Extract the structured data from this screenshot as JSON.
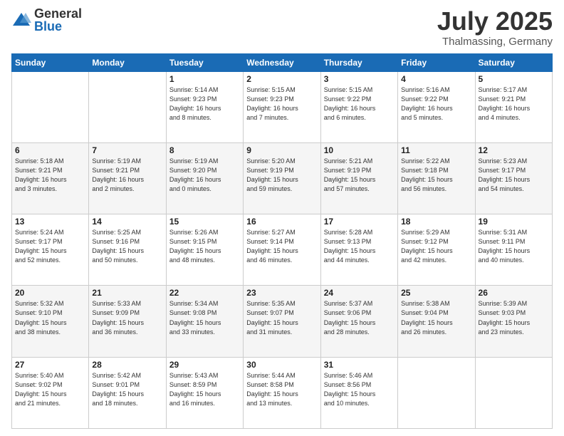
{
  "logo": {
    "general": "General",
    "blue": "Blue"
  },
  "title": "July 2025",
  "location": "Thalmassing, Germany",
  "weekdays": [
    "Sunday",
    "Monday",
    "Tuesday",
    "Wednesday",
    "Thursday",
    "Friday",
    "Saturday"
  ],
  "weeks": [
    [
      {
        "day": "",
        "info": ""
      },
      {
        "day": "",
        "info": ""
      },
      {
        "day": "1",
        "info": "Sunrise: 5:14 AM\nSunset: 9:23 PM\nDaylight: 16 hours\nand 8 minutes."
      },
      {
        "day": "2",
        "info": "Sunrise: 5:15 AM\nSunset: 9:23 PM\nDaylight: 16 hours\nand 7 minutes."
      },
      {
        "day": "3",
        "info": "Sunrise: 5:15 AM\nSunset: 9:22 PM\nDaylight: 16 hours\nand 6 minutes."
      },
      {
        "day": "4",
        "info": "Sunrise: 5:16 AM\nSunset: 9:22 PM\nDaylight: 16 hours\nand 5 minutes."
      },
      {
        "day": "5",
        "info": "Sunrise: 5:17 AM\nSunset: 9:21 PM\nDaylight: 16 hours\nand 4 minutes."
      }
    ],
    [
      {
        "day": "6",
        "info": "Sunrise: 5:18 AM\nSunset: 9:21 PM\nDaylight: 16 hours\nand 3 minutes."
      },
      {
        "day": "7",
        "info": "Sunrise: 5:19 AM\nSunset: 9:21 PM\nDaylight: 16 hours\nand 2 minutes."
      },
      {
        "day": "8",
        "info": "Sunrise: 5:19 AM\nSunset: 9:20 PM\nDaylight: 16 hours\nand 0 minutes."
      },
      {
        "day": "9",
        "info": "Sunrise: 5:20 AM\nSunset: 9:19 PM\nDaylight: 15 hours\nand 59 minutes."
      },
      {
        "day": "10",
        "info": "Sunrise: 5:21 AM\nSunset: 9:19 PM\nDaylight: 15 hours\nand 57 minutes."
      },
      {
        "day": "11",
        "info": "Sunrise: 5:22 AM\nSunset: 9:18 PM\nDaylight: 15 hours\nand 56 minutes."
      },
      {
        "day": "12",
        "info": "Sunrise: 5:23 AM\nSunset: 9:17 PM\nDaylight: 15 hours\nand 54 minutes."
      }
    ],
    [
      {
        "day": "13",
        "info": "Sunrise: 5:24 AM\nSunset: 9:17 PM\nDaylight: 15 hours\nand 52 minutes."
      },
      {
        "day": "14",
        "info": "Sunrise: 5:25 AM\nSunset: 9:16 PM\nDaylight: 15 hours\nand 50 minutes."
      },
      {
        "day": "15",
        "info": "Sunrise: 5:26 AM\nSunset: 9:15 PM\nDaylight: 15 hours\nand 48 minutes."
      },
      {
        "day": "16",
        "info": "Sunrise: 5:27 AM\nSunset: 9:14 PM\nDaylight: 15 hours\nand 46 minutes."
      },
      {
        "day": "17",
        "info": "Sunrise: 5:28 AM\nSunset: 9:13 PM\nDaylight: 15 hours\nand 44 minutes."
      },
      {
        "day": "18",
        "info": "Sunrise: 5:29 AM\nSunset: 9:12 PM\nDaylight: 15 hours\nand 42 minutes."
      },
      {
        "day": "19",
        "info": "Sunrise: 5:31 AM\nSunset: 9:11 PM\nDaylight: 15 hours\nand 40 minutes."
      }
    ],
    [
      {
        "day": "20",
        "info": "Sunrise: 5:32 AM\nSunset: 9:10 PM\nDaylight: 15 hours\nand 38 minutes."
      },
      {
        "day": "21",
        "info": "Sunrise: 5:33 AM\nSunset: 9:09 PM\nDaylight: 15 hours\nand 36 minutes."
      },
      {
        "day": "22",
        "info": "Sunrise: 5:34 AM\nSunset: 9:08 PM\nDaylight: 15 hours\nand 33 minutes."
      },
      {
        "day": "23",
        "info": "Sunrise: 5:35 AM\nSunset: 9:07 PM\nDaylight: 15 hours\nand 31 minutes."
      },
      {
        "day": "24",
        "info": "Sunrise: 5:37 AM\nSunset: 9:06 PM\nDaylight: 15 hours\nand 28 minutes."
      },
      {
        "day": "25",
        "info": "Sunrise: 5:38 AM\nSunset: 9:04 PM\nDaylight: 15 hours\nand 26 minutes."
      },
      {
        "day": "26",
        "info": "Sunrise: 5:39 AM\nSunset: 9:03 PM\nDaylight: 15 hours\nand 23 minutes."
      }
    ],
    [
      {
        "day": "27",
        "info": "Sunrise: 5:40 AM\nSunset: 9:02 PM\nDaylight: 15 hours\nand 21 minutes."
      },
      {
        "day": "28",
        "info": "Sunrise: 5:42 AM\nSunset: 9:01 PM\nDaylight: 15 hours\nand 18 minutes."
      },
      {
        "day": "29",
        "info": "Sunrise: 5:43 AM\nSunset: 8:59 PM\nDaylight: 15 hours\nand 16 minutes."
      },
      {
        "day": "30",
        "info": "Sunrise: 5:44 AM\nSunset: 8:58 PM\nDaylight: 15 hours\nand 13 minutes."
      },
      {
        "day": "31",
        "info": "Sunrise: 5:46 AM\nSunset: 8:56 PM\nDaylight: 15 hours\nand 10 minutes."
      },
      {
        "day": "",
        "info": ""
      },
      {
        "day": "",
        "info": ""
      }
    ]
  ]
}
